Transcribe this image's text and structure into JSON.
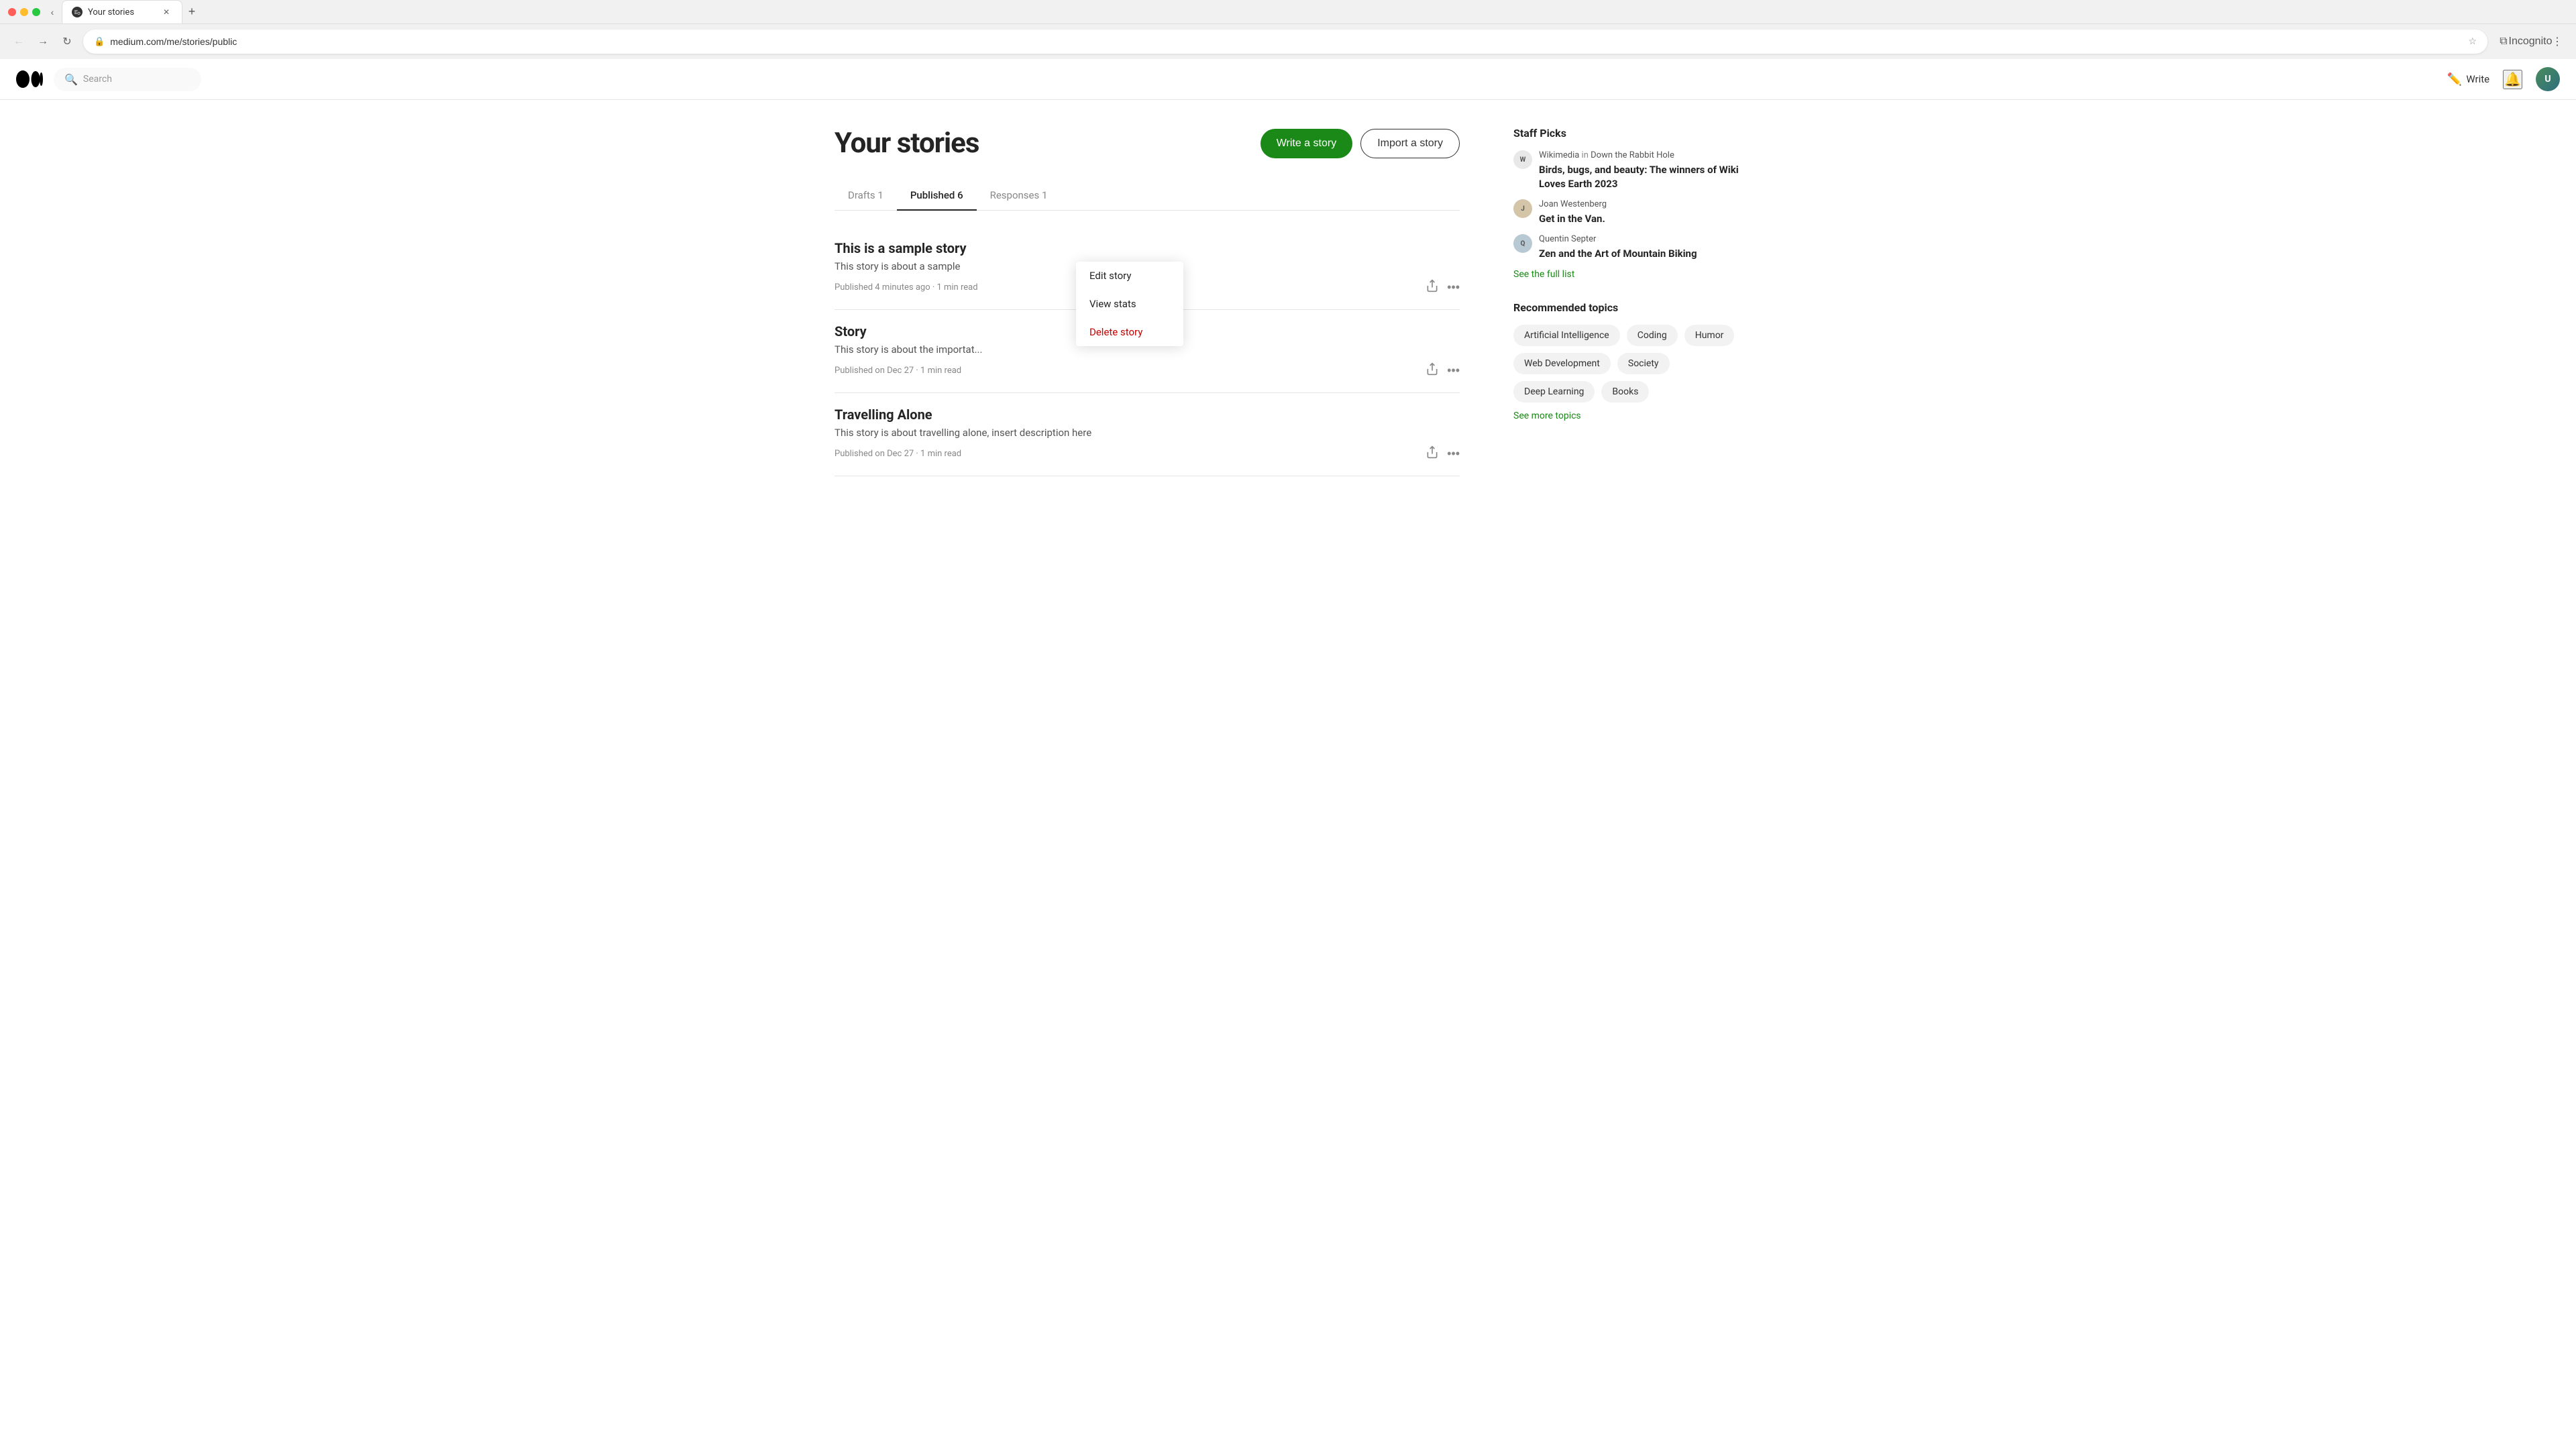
{
  "browser": {
    "url": "medium.com/me/stories/public",
    "tab_title": "Your stories",
    "incognito_label": "Incognito",
    "new_tab_label": "+"
  },
  "header": {
    "search_placeholder": "Search",
    "write_label": "Write",
    "logo_alt": "Medium"
  },
  "page": {
    "title": "Your stories",
    "write_story_btn": "Write a story",
    "import_story_btn": "Import a story"
  },
  "tabs": [
    {
      "label": "Drafts 1",
      "active": false,
      "id": "drafts"
    },
    {
      "label": "Published 6",
      "active": true,
      "id": "published"
    },
    {
      "label": "Responses 1",
      "active": false,
      "id": "responses"
    }
  ],
  "stories": [
    {
      "id": "story-1",
      "title": "This is a sample story",
      "subtitle": "This story is about a sample",
      "meta": "Published 4 minutes ago · 1 min read",
      "has_menu": true,
      "menu_open": true
    },
    {
      "id": "story-2",
      "title": "Story",
      "subtitle": "This story is about the importat...",
      "meta": "Published on Dec 27 · 1 min read",
      "has_menu": true,
      "menu_open": false
    },
    {
      "id": "story-3",
      "title": "Travelling Alone",
      "subtitle": "This story is about travelling alone, insert description here",
      "meta": "Published on Dec 27 · 1 min read",
      "has_menu": true,
      "menu_open": false
    }
  ],
  "context_menu": {
    "items": [
      {
        "label": "Edit story",
        "id": "edit-story",
        "type": "normal"
      },
      {
        "label": "View stats",
        "id": "view-stats",
        "type": "normal"
      },
      {
        "label": "Delete story",
        "id": "delete-story",
        "type": "delete"
      }
    ]
  },
  "sidebar": {
    "staff_picks_title": "Staff Picks",
    "staff_picks": [
      {
        "author": "Wikimedia",
        "publication": "Down the Rabbit Hole",
        "title": "Birds, bugs, and beauty: The winners of Wiki Loves Earth 2023",
        "avatar_text": "W"
      },
      {
        "author": "Joan Westenberg",
        "publication": "",
        "title": "Get in the Van.",
        "avatar_text": "J"
      },
      {
        "author": "Quentin Septer",
        "publication": "",
        "title": "Zen and the Art of Mountain Biking",
        "avatar_text": "Q"
      }
    ],
    "see_full_list": "See the full list",
    "recommended_topics_title": "Recommended topics",
    "topics": [
      "Artificial Intelligence",
      "Coding",
      "Humor",
      "Web Development",
      "Society",
      "Deep Learning",
      "Books"
    ],
    "see_more_topics": "See more topics"
  }
}
